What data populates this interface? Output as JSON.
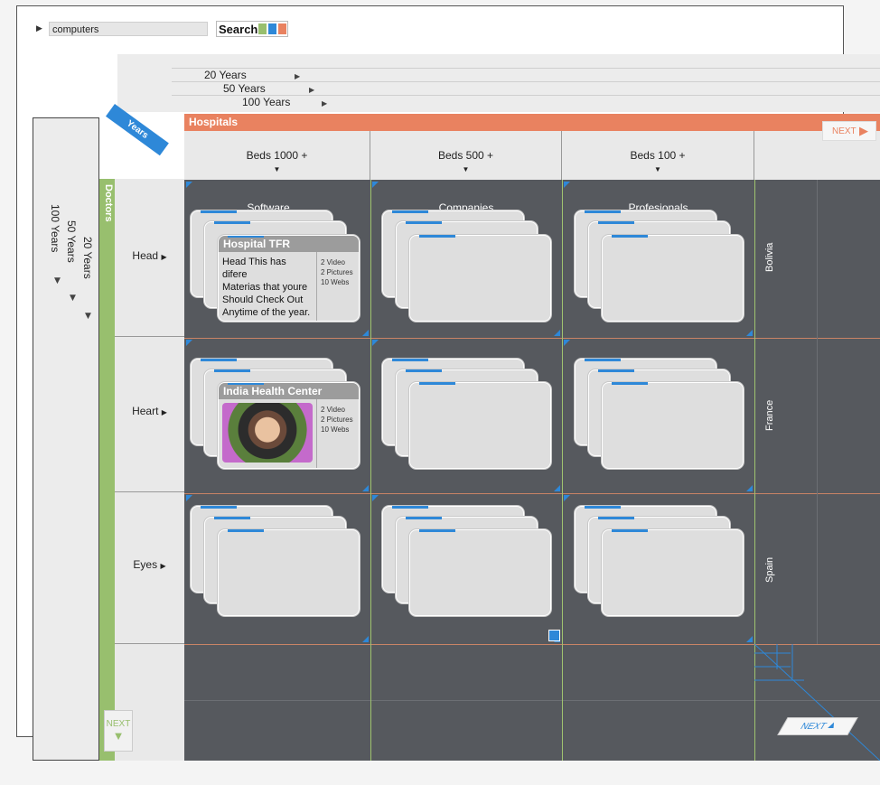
{
  "search": {
    "value": "computers",
    "button_label": "Search"
  },
  "years_operating": {
    "label": "Years Operating",
    "options_top": [
      "20 Years",
      "50 Years",
      "100 Years"
    ],
    "options_side": [
      "100 Years",
      "50 Years",
      "20 Years"
    ]
  },
  "category": {
    "label": "Hospitals",
    "next_label": "NEXT"
  },
  "columns": [
    "Beds 1000 +",
    "Beds 500 +",
    "Beds 100 +"
  ],
  "doctors": {
    "label": "Doctors",
    "next_label": "NEXT"
  },
  "rows": [
    "Head",
    "Heart",
    "Eyes"
  ],
  "countries": [
    "Bolivia",
    "France",
    "Spain"
  ],
  "bottom_labels": [
    "Software",
    "Companies",
    "Profesionals"
  ],
  "bottom_next_label": "NEXT",
  "cards": {
    "hospital": {
      "title": "Hospital TFR",
      "body": [
        "Head This has difere",
        "Materias that youre",
        "Should Check Out",
        "Anytime of the year."
      ],
      "stats": [
        "2 Video",
        "2 Pictures",
        "10 Webs"
      ]
    },
    "india": {
      "title": "India Health Center",
      "stats": [
        "2 Video",
        "2 Pictures",
        "10 Webs"
      ]
    }
  },
  "colors": {
    "accent_blue": "#2e88d8",
    "hospital_orange": "#e98260",
    "doctors_green": "#98bf6e",
    "grid_dark": "#56595e"
  }
}
